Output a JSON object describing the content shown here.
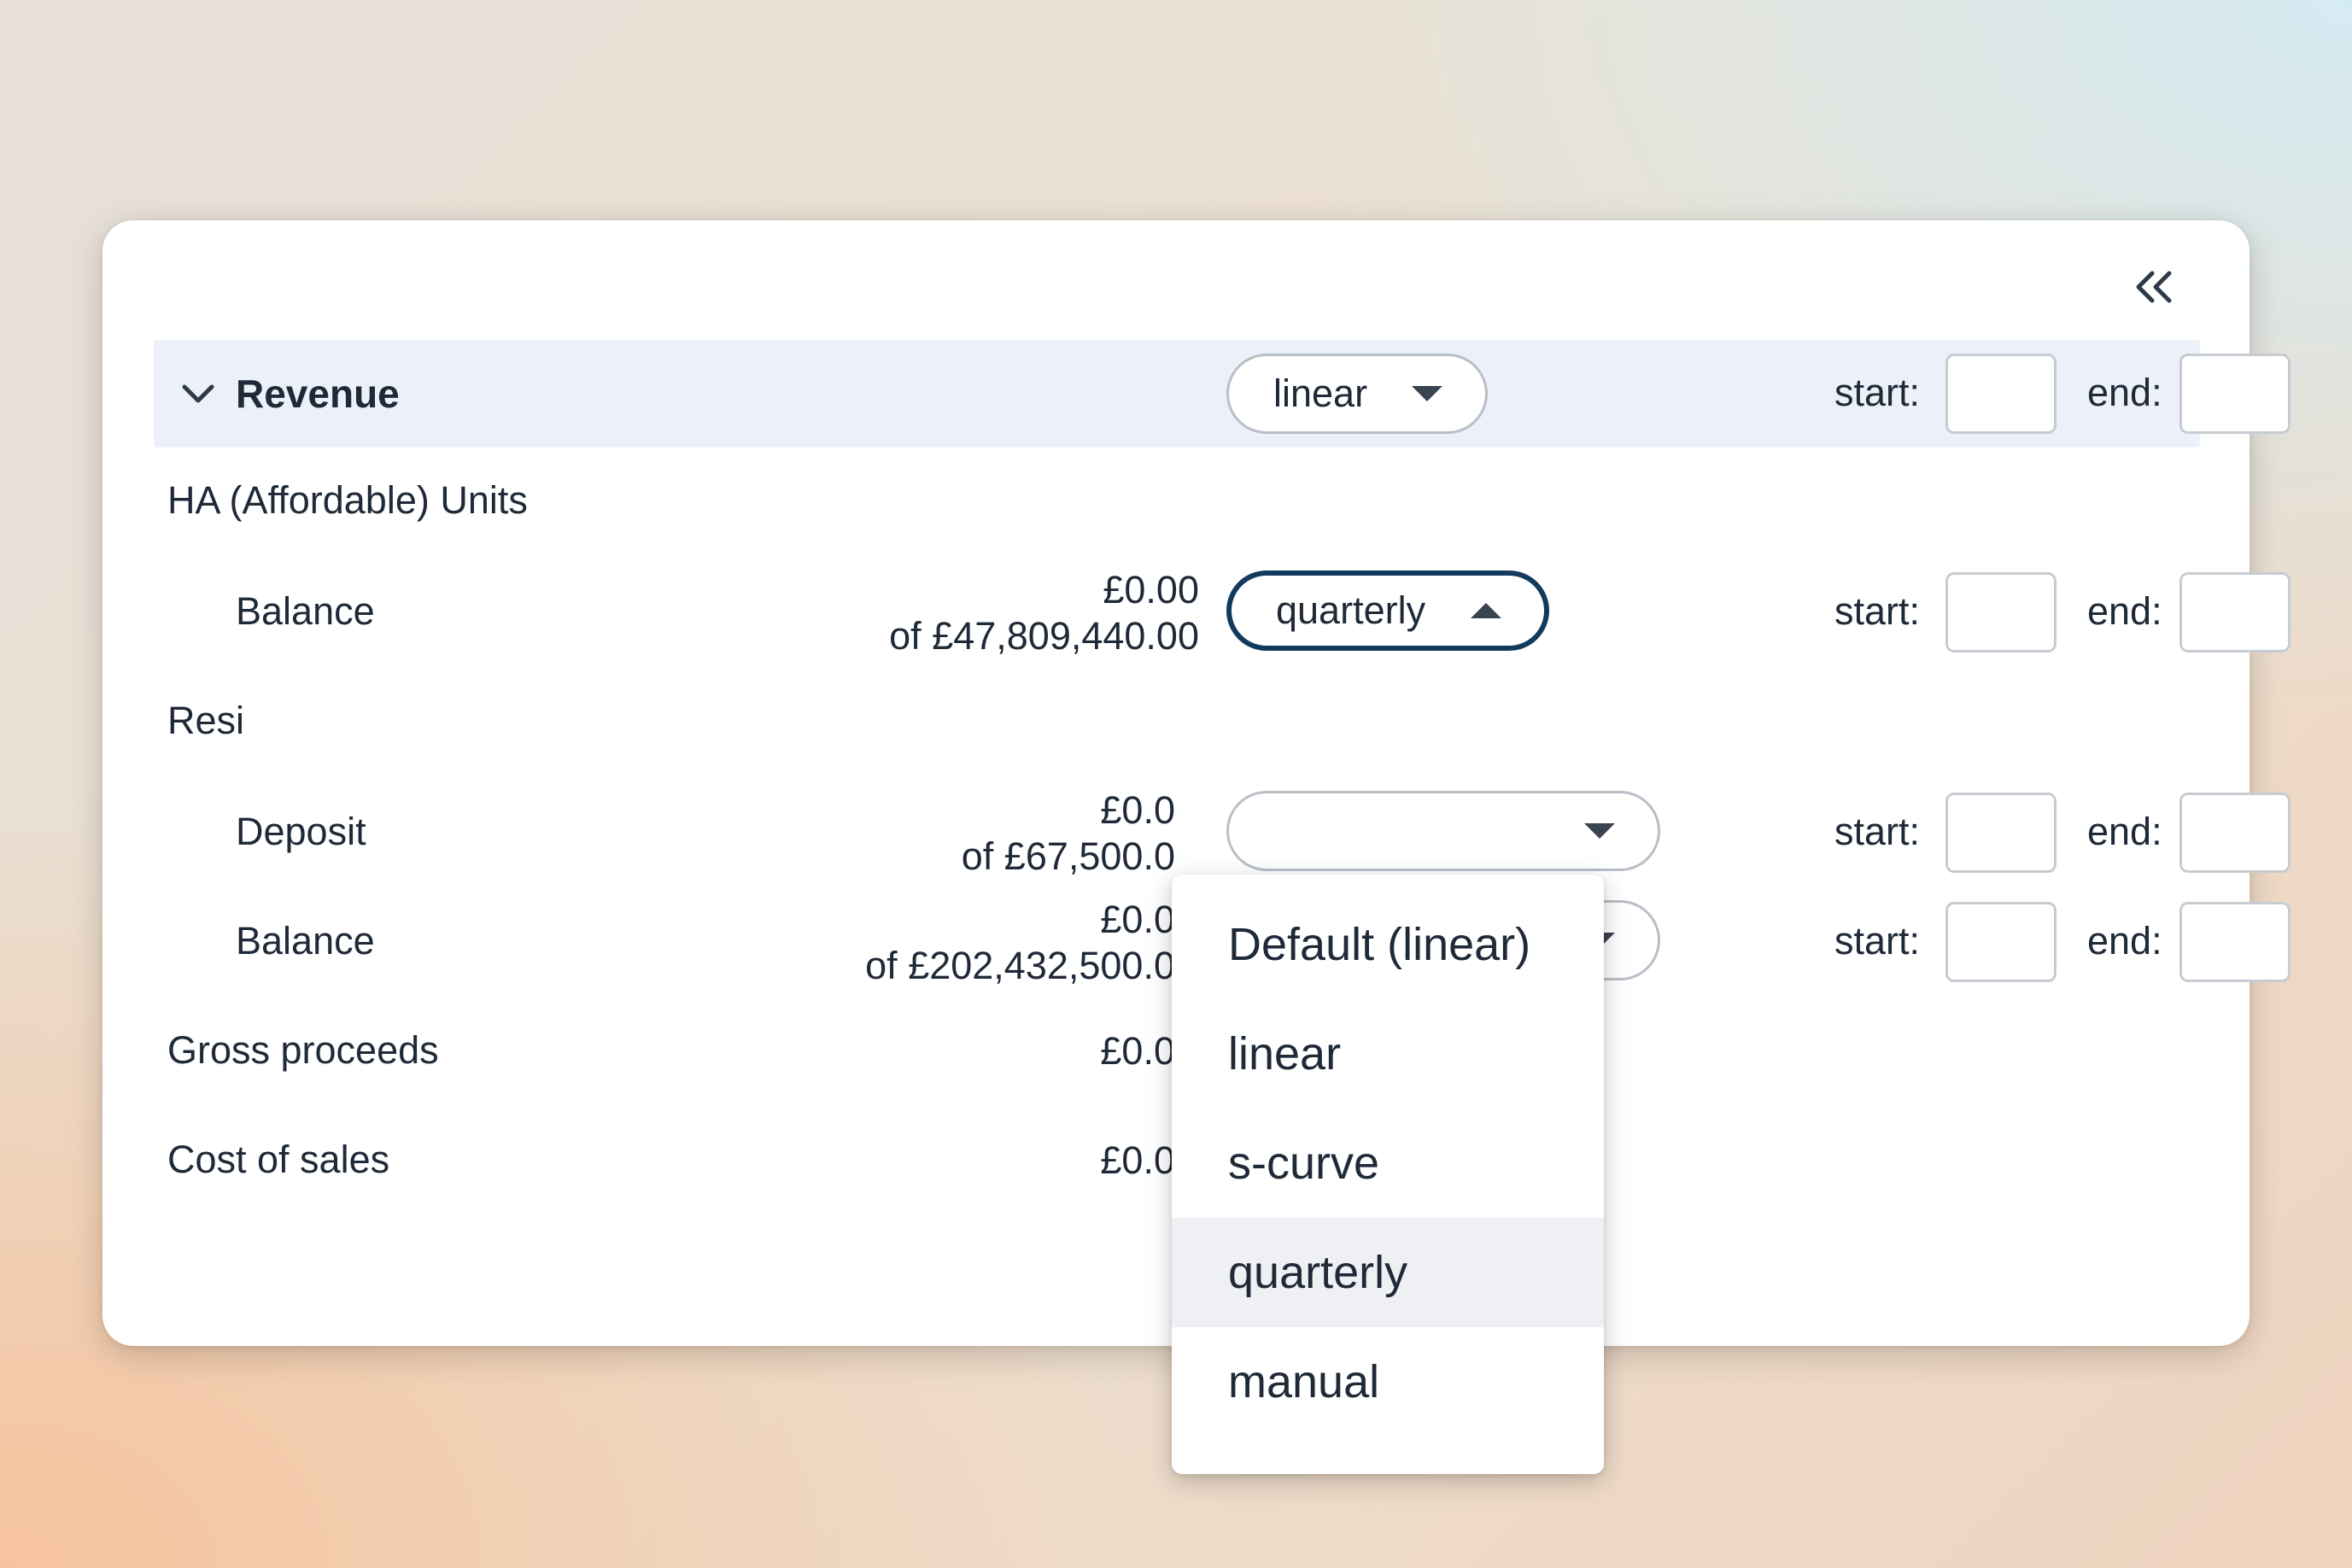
{
  "toolbar": {
    "collapse_icon": "double-chevron-left-icon"
  },
  "section": {
    "title": "Revenue",
    "icon": "chevron-down-icon",
    "method": "linear",
    "start_label": "start:",
    "end_label": "end:"
  },
  "groups": [
    {
      "name": "HA (Affordable) Units",
      "items": [
        {
          "label": "Balance",
          "amount": "£0.00",
          "total": "of £47,809,440.00",
          "method": "quarterly",
          "start_label": "start:",
          "end_label": "end:"
        }
      ]
    },
    {
      "name": "Resi",
      "items": [
        {
          "label": "Deposit",
          "amount": "£0.0",
          "total": "of £67,500.0",
          "start_label": "start:",
          "end_label": "end:"
        },
        {
          "label": "Balance",
          "amount": "£0.0",
          "total": "of £202,432,500.0",
          "start_label": "start:",
          "end_label": "end:"
        }
      ]
    }
  ],
  "summary": [
    {
      "label": "Gross proceeds",
      "amount": "£0.0"
    },
    {
      "label": "Cost of sales",
      "amount": "£0.0"
    }
  ],
  "dropdown": {
    "options": [
      "Default (linear)",
      "linear",
      "s-curve",
      "quarterly",
      "manual"
    ],
    "selected": "quarterly"
  },
  "colors": {
    "header_bg": "#ecf1f9",
    "active_border": "#123a5c",
    "selected_option_bg": "#eef0f3"
  }
}
